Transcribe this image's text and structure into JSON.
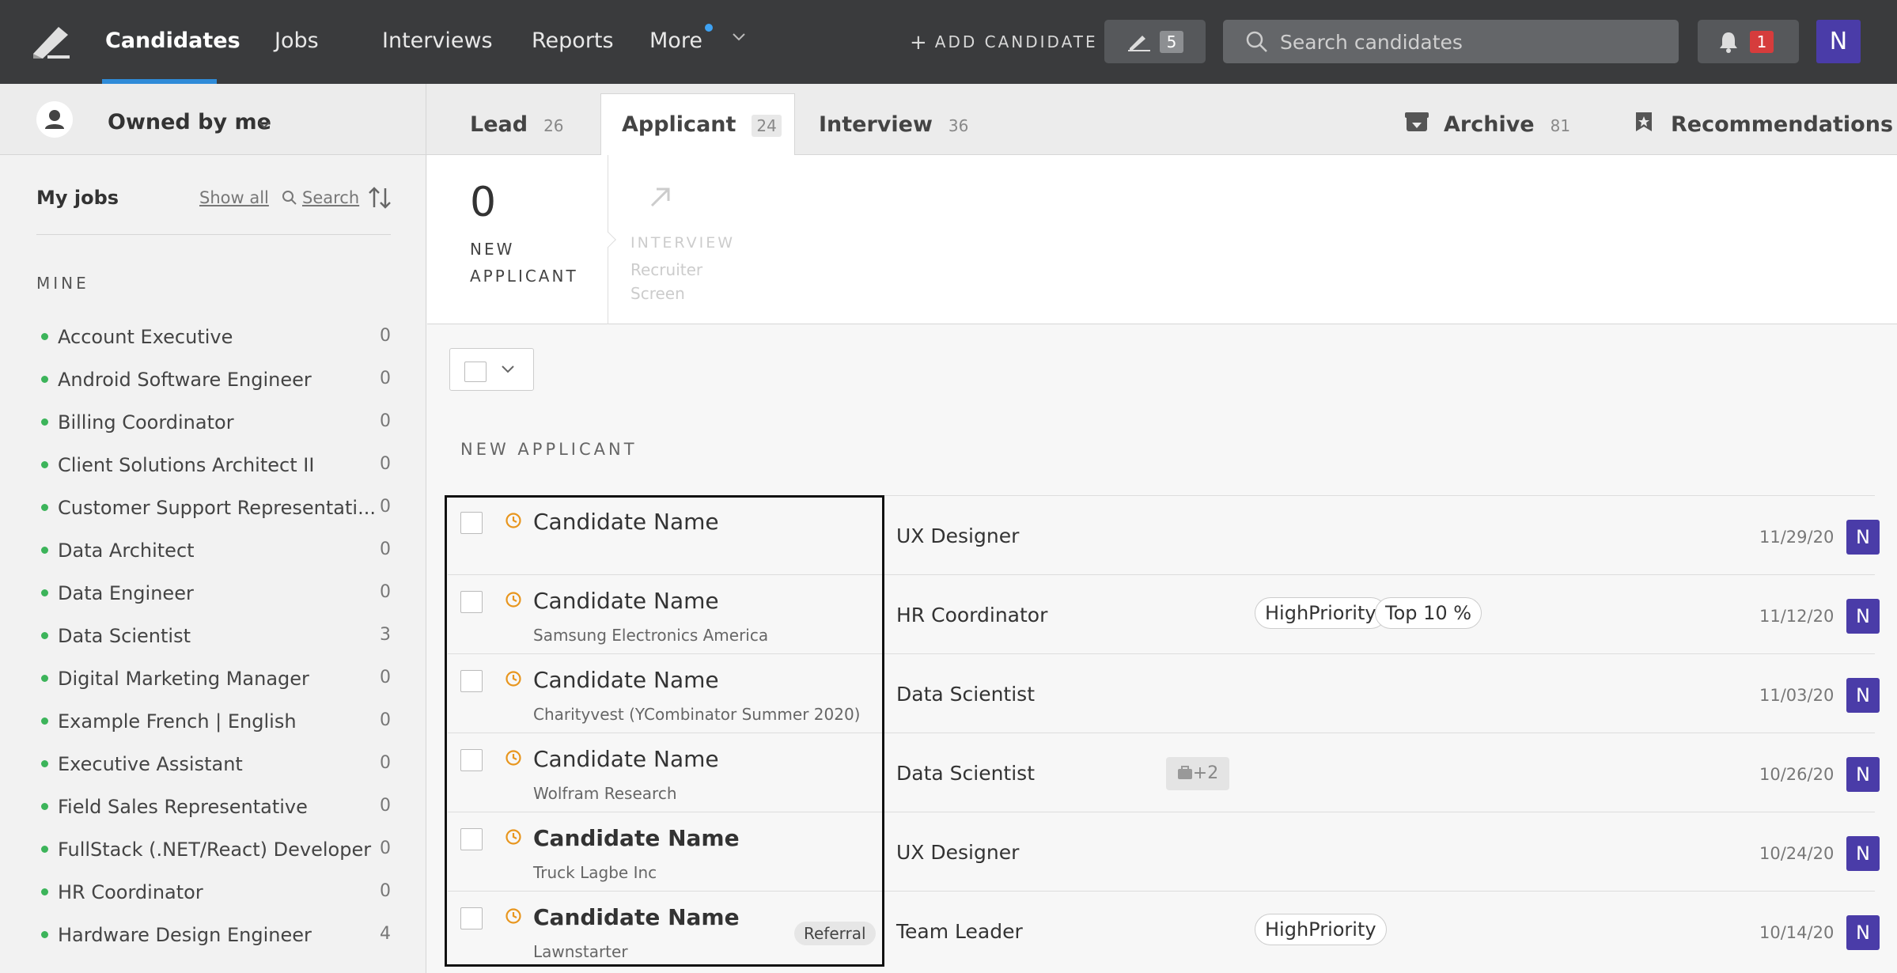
{
  "nav": {
    "items": [
      "Candidates",
      "Jobs",
      "Interviews",
      "Reports",
      "More"
    ],
    "add_candidate": "ADD CANDIDATE",
    "pen_count": "5",
    "search_placeholder": "Search candidates",
    "notification_count": "1",
    "user_initial": "N"
  },
  "subbar": {
    "owner": "Owned by me",
    "tabs": [
      {
        "label": "Lead",
        "count": "26"
      },
      {
        "label": "Applicant",
        "count": "24"
      },
      {
        "label": "Interview",
        "count": "36"
      }
    ],
    "archive": {
      "label": "Archive",
      "count": "81"
    },
    "recommendations": "Recommendations"
  },
  "sidebar": {
    "title": "My jobs",
    "show_all": "Show all",
    "search": "Search",
    "section": "MINE",
    "jobs": [
      {
        "name": "Account Executive",
        "count": "0"
      },
      {
        "name": "Android Software Engineer",
        "count": "0"
      },
      {
        "name": "Billing Coordinator",
        "count": "0"
      },
      {
        "name": "Client Solutions Architect II",
        "count": "0"
      },
      {
        "name": "Customer Support Representati...",
        "count": "0"
      },
      {
        "name": "Data Architect",
        "count": "0"
      },
      {
        "name": "Data Engineer",
        "count": "0"
      },
      {
        "name": "Data Scientist",
        "count": "3"
      },
      {
        "name": "Digital Marketing Manager",
        "count": "0"
      },
      {
        "name": "Example French | English",
        "count": "0"
      },
      {
        "name": "Executive Assistant",
        "count": "0"
      },
      {
        "name": "Field Sales Representative",
        "count": "0"
      },
      {
        "name": "FullStack (.NET/React) Developer",
        "count": "0"
      },
      {
        "name": "HR Coordinator",
        "count": "0"
      },
      {
        "name": "Hardware Design Engineer",
        "count": "4"
      }
    ]
  },
  "stages": {
    "new_applicant": {
      "count": "0",
      "label": "NEW APPLICANT"
    },
    "interview": {
      "label": "INTERVIEW",
      "sub": "Recruiter Screen"
    }
  },
  "list": {
    "section_title": "NEW APPLICANT",
    "rows": [
      {
        "name": "Candidate Name",
        "company": "",
        "job": "UX Designer",
        "tags": [],
        "date": "11/29/20",
        "owner": "N"
      },
      {
        "name": "Candidate Name",
        "company": "Samsung Electronics America",
        "job": "HR Coordinator",
        "tags": [
          "HighPriority",
          "Top 10 %"
        ],
        "date": "11/12/20",
        "owner": "N"
      },
      {
        "name": "Candidate Name",
        "company": "Charityvest (YCombinator Summer 2020)",
        "job": "Data Scientist",
        "tags": [],
        "date": "11/03/20",
        "owner": "N"
      },
      {
        "name": "Candidate Name",
        "company": "Wolfram Research",
        "job": "Data Scientist",
        "tags": [],
        "extra": "+2",
        "date": "10/26/20",
        "owner": "N"
      },
      {
        "name": "Candidate Name",
        "company": "Truck Lagbe Inc",
        "job": "UX Designer",
        "tags": [],
        "date": "10/24/20",
        "owner": "N"
      },
      {
        "name": "Candidate Name",
        "company": "Lawnstarter",
        "job": "Team Leader",
        "tags": [
          "HighPriority"
        ],
        "referral": "Referral",
        "date": "10/14/20",
        "owner": "N"
      }
    ]
  },
  "colors": {
    "accent": "#2f8bd8",
    "avatar": "#4a3ca8",
    "topbar": "#3a3b3d",
    "job_dot": "#3cb45a",
    "clock": "#e8961e"
  }
}
